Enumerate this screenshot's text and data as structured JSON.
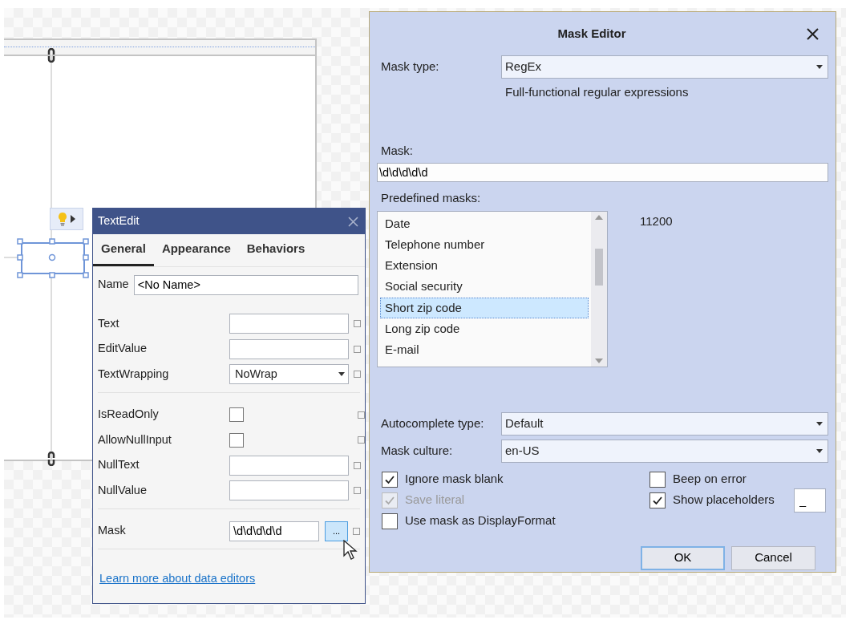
{
  "text_edit": {
    "title": "TextEdit",
    "tabs": [
      {
        "label": "General",
        "selected": true
      },
      {
        "label": "Appearance",
        "selected": false
      },
      {
        "label": "Behaviors",
        "selected": false
      }
    ],
    "name_label": "Name",
    "name_value": "<No Name>",
    "groups": [
      {
        "properties": [
          {
            "kind": "text",
            "label": "Text"
          },
          {
            "kind": "text",
            "label": "EditValue"
          },
          {
            "kind": "dropdown",
            "label": "TextWrapping",
            "value": "NoWrap"
          }
        ]
      },
      {
        "properties": [
          {
            "kind": "checkbox",
            "label": "IsReadOnly",
            "checked": false
          },
          {
            "kind": "checkbox",
            "label": "AllowNullInput",
            "checked": false
          },
          {
            "kind": "text",
            "label": "NullText"
          },
          {
            "kind": "text",
            "label": "NullValue"
          }
        ]
      },
      {
        "properties": [
          {
            "kind": "editor",
            "label": "Mask",
            "value": "\\d\\d\\d\\d\\d",
            "button": "..."
          }
        ]
      }
    ],
    "link": "Learn more about data editors"
  },
  "mask_editor": {
    "title": "Mask Editor",
    "mask_type": {
      "label": "Mask type:",
      "value": "RegEx"
    },
    "description": "Full-functional regular expressions",
    "mask_label": "Mask:",
    "mask_value": "\\d\\d\\d\\d\\d",
    "predefined_label": "Predefined masks:",
    "predefined": [
      {
        "label": "Date",
        "selected": false
      },
      {
        "label": "Telephone number",
        "selected": false
      },
      {
        "label": "Extension",
        "selected": false
      },
      {
        "label": "Social security",
        "selected": false
      },
      {
        "label": "Short zip code",
        "selected": true
      },
      {
        "label": "Long zip code",
        "selected": false
      },
      {
        "label": "E-mail",
        "selected": false
      }
    ],
    "sample": "11200",
    "autocomplete": {
      "label": "Autocomplete type:",
      "value": "Default"
    },
    "culture": {
      "label": "Mask culture:",
      "value": "en-US"
    },
    "options_left": [
      {
        "label": "Ignore mask blank",
        "checked": true,
        "disabled": false
      },
      {
        "label": "Save literal",
        "checked": true,
        "disabled": true
      },
      {
        "label": "Use mask as DisplayFormat",
        "checked": false,
        "disabled": false
      }
    ],
    "options_right": [
      {
        "label": "Beep on error",
        "checked": false,
        "disabled": false
      },
      {
        "label": "Show placeholders",
        "checked": true,
        "disabled": false,
        "value": "_"
      }
    ],
    "buttons": [
      {
        "label": "OK",
        "default": true
      },
      {
        "label": "Cancel",
        "default": false
      }
    ]
  }
}
